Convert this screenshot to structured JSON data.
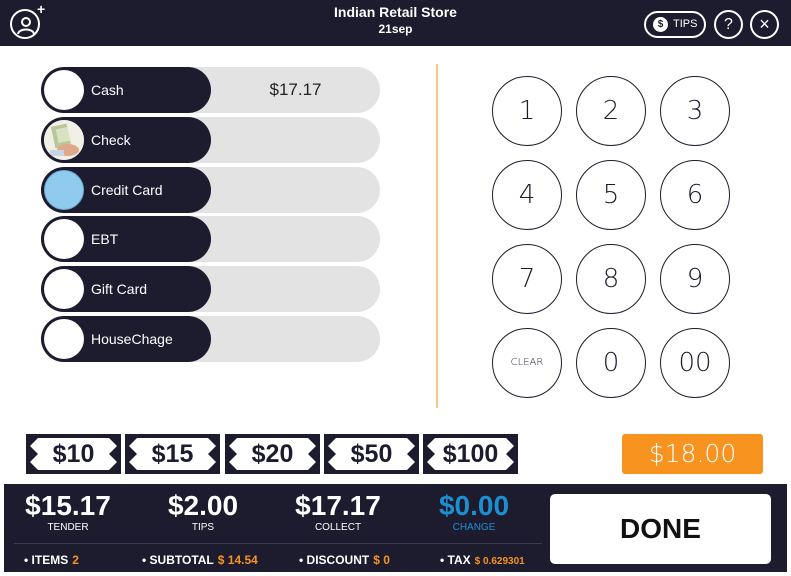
{
  "header": {
    "title": "Indian Retail Store",
    "subtitle": "21sep",
    "add_user_symbol": "+",
    "tips_coin": "$",
    "tips_label": "TIPS",
    "help_symbol": "?",
    "close_symbol": "×"
  },
  "payment_methods": [
    {
      "label": "Cash",
      "amount": "$17.17",
      "icon": "cash-icon"
    },
    {
      "label": "Check",
      "amount": "",
      "icon": "check-photo-icon"
    },
    {
      "label": "Credit Card",
      "amount": "",
      "icon": "credit-card-icon"
    },
    {
      "label": "EBT",
      "amount": "",
      "icon": "ebt-icon"
    },
    {
      "label": "Gift Card",
      "amount": "",
      "icon": "gift-card-icon"
    },
    {
      "label": "HouseChage",
      "amount": "",
      "icon": "house-charge-icon"
    }
  ],
  "keypad": [
    "1",
    "2",
    "3",
    "4",
    "5",
    "6",
    "7",
    "8",
    "9",
    "CLEAR",
    "0",
    "00"
  ],
  "quick_cash": [
    "$10",
    "$15",
    "$20",
    "$50",
    "$100"
  ],
  "total_button": "$18.00",
  "footer": {
    "tender": {
      "value": "$15.17",
      "label": "TENDER"
    },
    "tips": {
      "value": "$2.00",
      "label": "TIPS"
    },
    "collect": {
      "value": "$17.17",
      "label": "COLLECT"
    },
    "change": {
      "value": "$0.00",
      "label": "CHANGE"
    },
    "done_label": "DONE",
    "items": {
      "label": "• ITEMS",
      "value": "2"
    },
    "subtotal": {
      "label": "• SUBTOTAL",
      "value": "$ 14.54"
    },
    "discount": {
      "label": "• DISCOUNT",
      "value": "$ 0"
    },
    "tax": {
      "label": "• TAX",
      "value": "$ 0.629301"
    }
  },
  "colors": {
    "navy": "#1c1c2e",
    "orange": "#f7931e",
    "change_blue": "#1d8fd1",
    "track_gray": "#e3e3e3",
    "credit_card_circle": "#8fcbee"
  }
}
